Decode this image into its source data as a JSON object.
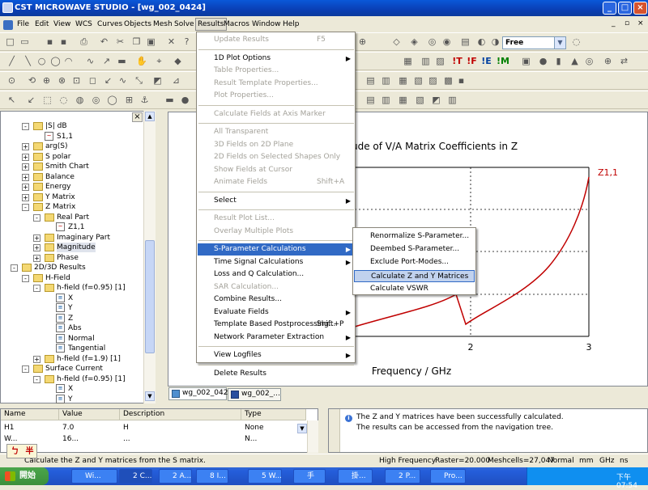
{
  "window": {
    "title": "CST MICROWAVE STUDIO - [wg_002_0424]",
    "minimize": "_",
    "maximize": "□",
    "close": "×",
    "doc_min": "_",
    "doc_restore": "▫",
    "doc_close": "×"
  },
  "menubar": [
    "File",
    "Edit",
    "View",
    "WCS",
    "Curves",
    "Objects",
    "Mesh",
    "Solve",
    "Results",
    "Macros",
    "Window",
    "Help"
  ],
  "toolbar": {
    "combo_value": "Free"
  },
  "tree": [
    {
      "label": "|S| dB",
      "kind": "folder",
      "exp": "-",
      "level": 1
    },
    {
      "label": "S1,1",
      "kind": "curve",
      "level": 2
    },
    {
      "label": "arg(S)",
      "kind": "folder",
      "exp": "+",
      "level": 1
    },
    {
      "label": "S polar",
      "kind": "folder",
      "exp": "+",
      "level": 1
    },
    {
      "label": "Smith Chart",
      "kind": "folder",
      "exp": "+",
      "level": 1
    },
    {
      "label": "Balance",
      "kind": "folder",
      "exp": "+",
      "level": 1
    },
    {
      "label": "Energy",
      "kind": "folder",
      "exp": "+",
      "level": 1
    },
    {
      "label": "Y Matrix",
      "kind": "folder",
      "exp": "+",
      "level": 1
    },
    {
      "label": "Z Matrix",
      "kind": "folder",
      "exp": "-",
      "level": 1
    },
    {
      "label": "Real Part",
      "kind": "folder",
      "exp": "-",
      "level": 2
    },
    {
      "label": "Z1,1",
      "kind": "curve",
      "level": 3
    },
    {
      "label": "Imaginary Part",
      "kind": "folder",
      "exp": "+",
      "level": 2
    },
    {
      "label": "Magnitude",
      "kind": "folder",
      "exp": "+",
      "level": 2,
      "selected": true
    },
    {
      "label": "Phase",
      "kind": "folder",
      "exp": "+",
      "level": 2
    },
    {
      "label": "2D/3D Results",
      "kind": "folder",
      "exp": "-",
      "level": 0
    },
    {
      "label": "H-Field",
      "kind": "folder",
      "exp": "-",
      "level": 1
    },
    {
      "label": "h-field (f=0.95) [1]",
      "kind": "folder",
      "exp": "-",
      "level": 2
    },
    {
      "label": "X",
      "kind": "field",
      "level": 3
    },
    {
      "label": "Y",
      "kind": "field",
      "level": 3
    },
    {
      "label": "Z",
      "kind": "field",
      "level": 3
    },
    {
      "label": "Abs",
      "kind": "field",
      "level": 3
    },
    {
      "label": "Normal",
      "kind": "field",
      "level": 3
    },
    {
      "label": "Tangential",
      "kind": "field",
      "level": 3
    },
    {
      "label": "h-field (f=1.9) [1]",
      "kind": "folder",
      "exp": "+",
      "level": 2
    },
    {
      "label": "Surface Current",
      "kind": "folder",
      "exp": "-",
      "level": 1
    },
    {
      "label": "h-field (f=0.95) [1]",
      "kind": "folder",
      "exp": "-",
      "level": 2
    },
    {
      "label": "X",
      "kind": "field",
      "level": 3
    },
    {
      "label": "Y",
      "kind": "field",
      "level": 3
    }
  ],
  "chart": {
    "title_visible": "ude of V/A Matrix Coefficients in Z",
    "xlabel": "Frequency / GHz",
    "xticks": [
      "2",
      "3"
    ],
    "series_label": "Z1,1",
    "line_color": "#c00000"
  },
  "tabs": [
    "wg_002_0424",
    "wg_002_..."
  ],
  "results_menu": [
    {
      "label": "Update Results",
      "shortcut": "F5",
      "disabled": true
    },
    {
      "sep": true
    },
    {
      "label": "1D Plot Options",
      "submenu": true
    },
    {
      "label": "Table Properties...",
      "disabled": true
    },
    {
      "label": "Result Template Properties...",
      "disabled": true
    },
    {
      "label": "Plot Properties...",
      "disabled": true
    },
    {
      "sep": true
    },
    {
      "label": "Calculate Fields at Axis Marker",
      "disabled": true
    },
    {
      "sep": true
    },
    {
      "label": "All Transparent",
      "disabled": true
    },
    {
      "label": "3D Fields on 2D Plane",
      "disabled": true
    },
    {
      "label": "2D Fields on Selected Shapes Only",
      "disabled": true
    },
    {
      "label": "Show Fields at Cursor",
      "disabled": true
    },
    {
      "label": "Animate Fields",
      "shortcut": "Shift+A",
      "disabled": true
    },
    {
      "sep": true
    },
    {
      "label": "Select",
      "submenu": true
    },
    {
      "sep": true
    },
    {
      "label": "Result Plot List...",
      "disabled": true
    },
    {
      "label": "Overlay Multiple Plots",
      "disabled": true
    },
    {
      "sep": true
    },
    {
      "label": "S-Parameter Calculations",
      "submenu": true,
      "highlighted": true
    },
    {
      "label": "Time Signal Calculations",
      "submenu": true
    },
    {
      "label": "Loss and Q Calculation..."
    },
    {
      "label": "SAR Calculation...",
      "disabled": true
    },
    {
      "label": "Combine Results..."
    },
    {
      "label": "Evaluate Fields",
      "submenu": true
    },
    {
      "label": "Template Based Postprocessing...",
      "shortcut": "Shift+P"
    },
    {
      "label": "Network Parameter Extraction",
      "submenu": true
    },
    {
      "sep": true
    },
    {
      "label": "View Logfiles",
      "submenu": true
    },
    {
      "sep": true
    },
    {
      "label": "Delete Results"
    }
  ],
  "sparam_submenu": [
    {
      "label": "Renormalize S-Parameter..."
    },
    {
      "label": "Deembed S-Parameter..."
    },
    {
      "label": "Exclude Port-Modes..."
    },
    {
      "label": "Calculate Z and Y Matrices",
      "highlighted": true
    },
    {
      "label": "Calculate VSWR"
    }
  ],
  "params_table": {
    "headers": [
      "Name",
      "Value",
      "Description",
      "Type"
    ],
    "rows": [
      [
        "H1",
        "7.0",
        "H",
        "None"
      ],
      [
        "W...",
        "16...",
        "...",
        "N..."
      ]
    ]
  },
  "messages": [
    "The Z and Y matrices have been successfully calculated.",
    "The results can be accessed from the navigation tree."
  ],
  "status": {
    "text": "Calculate the Z and Y matrices from the S matrix.",
    "mode": "High Frequency",
    "raster": "Raster=20.000",
    "meshcells": "Meshcells=27,047",
    "normal": "Normal",
    "unit1": "mm",
    "unit2": "GHz",
    "unit3": "ns"
  },
  "ime": [
    "ㄅ",
    "半"
  ],
  "taskbar": {
    "start": "開始",
    "items": [
      "Wi...",
      "2 C...",
      "2 A...",
      "8 I...",
      "5 W...",
      "手",
      "掛...",
      "2 P...",
      "Pro..."
    ],
    "clock": "下午 07:54"
  }
}
